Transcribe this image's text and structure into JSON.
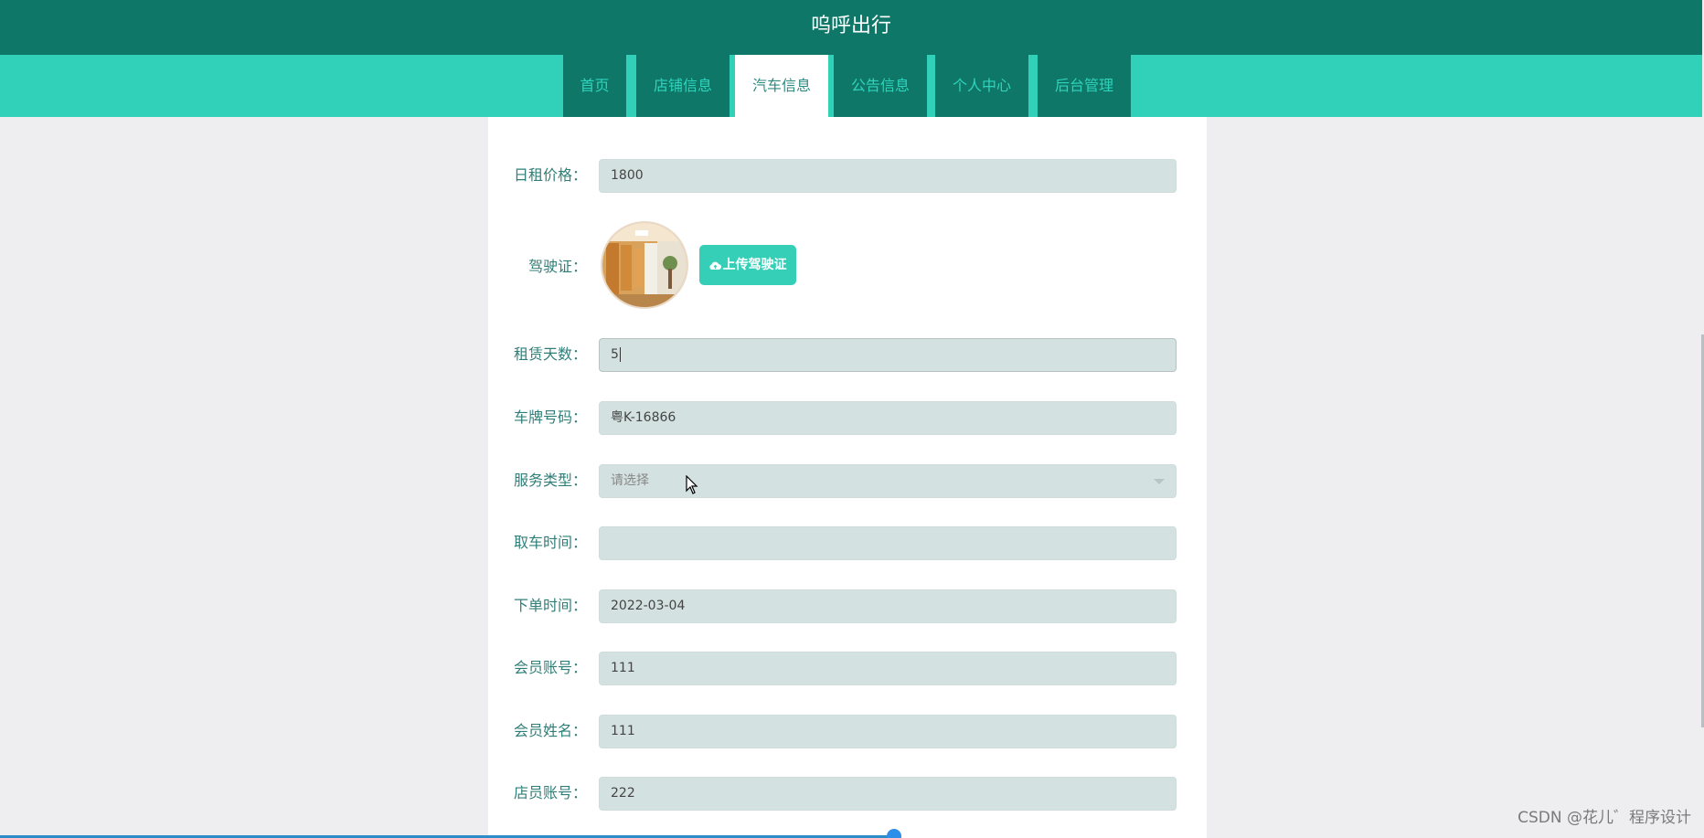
{
  "app": {
    "title": "呜呼出行"
  },
  "nav": {
    "items": [
      {
        "label": "首页"
      },
      {
        "label": "店铺信息"
      },
      {
        "label": "汽车信息"
      },
      {
        "label": "公告信息"
      },
      {
        "label": "个人中心"
      },
      {
        "label": "后台管理"
      }
    ],
    "active": "汽车信息"
  },
  "form": {
    "daily_price": {
      "label": "日租价格：",
      "value": "1800"
    },
    "license": {
      "label": "驾驶证：",
      "upload_label": "上传驾驶证"
    },
    "rent_days": {
      "label": "租赁天数：",
      "value": "5"
    },
    "plate": {
      "label": "车牌号码：",
      "value": "粤K-16866"
    },
    "service_type": {
      "label": "服务类型：",
      "placeholder": "请选择"
    },
    "pickup_time": {
      "label": "取车时间：",
      "value": ""
    },
    "order_time": {
      "label": "下单时间：",
      "value": "2022-03-04"
    },
    "member_account": {
      "label": "会员账号：",
      "value": "111"
    },
    "member_name": {
      "label": "会员姓名：",
      "value": "111"
    },
    "clerk_account": {
      "label": "店员账号：",
      "value": "222"
    }
  },
  "watermark": "CSDN @花儿゛程序设计",
  "colors": {
    "header": "#0f7767",
    "nav": "#31d0b8",
    "accent": "#35cfb8",
    "field_bg": "#d3e1e0",
    "label": "#2f7f78"
  }
}
